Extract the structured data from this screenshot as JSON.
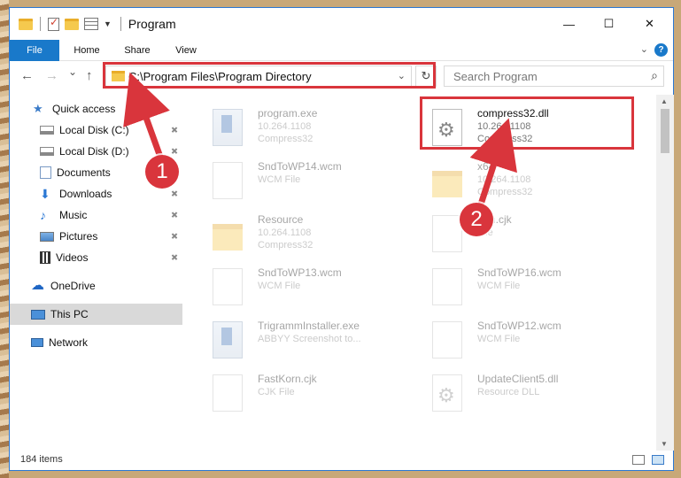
{
  "window": {
    "title": "Program",
    "controls": {
      "minimize": "—",
      "maximize": "☐",
      "close": "✕"
    }
  },
  "ribbon": {
    "tabs": [
      "File",
      "Home",
      "Share",
      "View"
    ],
    "help": "?"
  },
  "nav": {
    "back": "←",
    "forward": "→",
    "recent": "⌄",
    "up": "↑",
    "address": "C:\\Program Files\\Program Directory",
    "refresh": "↻",
    "search_placeholder": "Search Program"
  },
  "sidebar": {
    "items": [
      {
        "label": "Quick access",
        "icon": "star-icon"
      },
      {
        "label": "Local Disk (C:)",
        "icon": "drive-icon",
        "pinned": true
      },
      {
        "label": "Local Disk (D:)",
        "icon": "drive-icon",
        "pinned": true
      },
      {
        "label": "Documents",
        "icon": "documents-icon",
        "pinned": true
      },
      {
        "label": "Downloads",
        "icon": "download-icon",
        "pinned": true
      },
      {
        "label": "Music",
        "icon": "music-icon",
        "pinned": true
      },
      {
        "label": "Pictures",
        "icon": "pictures-icon",
        "pinned": true
      },
      {
        "label": "Videos",
        "icon": "videos-icon",
        "pinned": true
      },
      {
        "label": "OneDrive",
        "icon": "cloud-icon"
      },
      {
        "label": "This PC",
        "icon": "pc-icon",
        "selected": true
      },
      {
        "label": "Network",
        "icon": "network-icon"
      }
    ],
    "pin_glyph": "📌"
  },
  "files": [
    {
      "name": "program.exe",
      "line1": "10.264.1108",
      "line2": "Compress32",
      "type": "exe",
      "faded": true
    },
    {
      "name": "compress32.dll",
      "line1": "10.264.1108",
      "line2": "Compress32",
      "type": "dll",
      "faded": false
    },
    {
      "name": "SndToWP14.wcm",
      "line1": "WCM File",
      "line2": "",
      "type": "doc",
      "faded": true
    },
    {
      "name": "x64",
      "line1": "10.264.1108",
      "line2": "Compress32",
      "type": "folder",
      "faded": true
    },
    {
      "name": "Resource",
      "line1": "10.264.1108",
      "line2": "Compress32",
      "type": "folder",
      "faded": true
    },
    {
      "name": "tran.cjk",
      "line1": "File",
      "line2": "",
      "type": "doc",
      "faded": true
    },
    {
      "name": "SndToWP13.wcm",
      "line1": "WCM File",
      "line2": "",
      "type": "doc",
      "faded": true
    },
    {
      "name": "SndToWP16.wcm",
      "line1": "WCM File",
      "line2": "",
      "type": "doc",
      "faded": true
    },
    {
      "name": "TrigrammInstaller.exe",
      "line1": "ABBYY Screenshot to...",
      "line2": "",
      "type": "exe",
      "faded": true
    },
    {
      "name": "SndToWP12.wcm",
      "line1": "WCM File",
      "line2": "",
      "type": "doc",
      "faded": true
    },
    {
      "name": "FastKorn.cjk",
      "line1": "CJK File",
      "line2": "",
      "type": "doc",
      "faded": true
    },
    {
      "name": "UpdateClient5.dll",
      "line1": "Resource DLL",
      "line2": "",
      "type": "dll",
      "faded": true
    }
  ],
  "status": {
    "count": "184 items"
  },
  "callouts": [
    "1",
    "2"
  ],
  "colors": {
    "accent": "#1979ca",
    "highlight": "#d9353c",
    "selection": "#d9d9d9"
  }
}
